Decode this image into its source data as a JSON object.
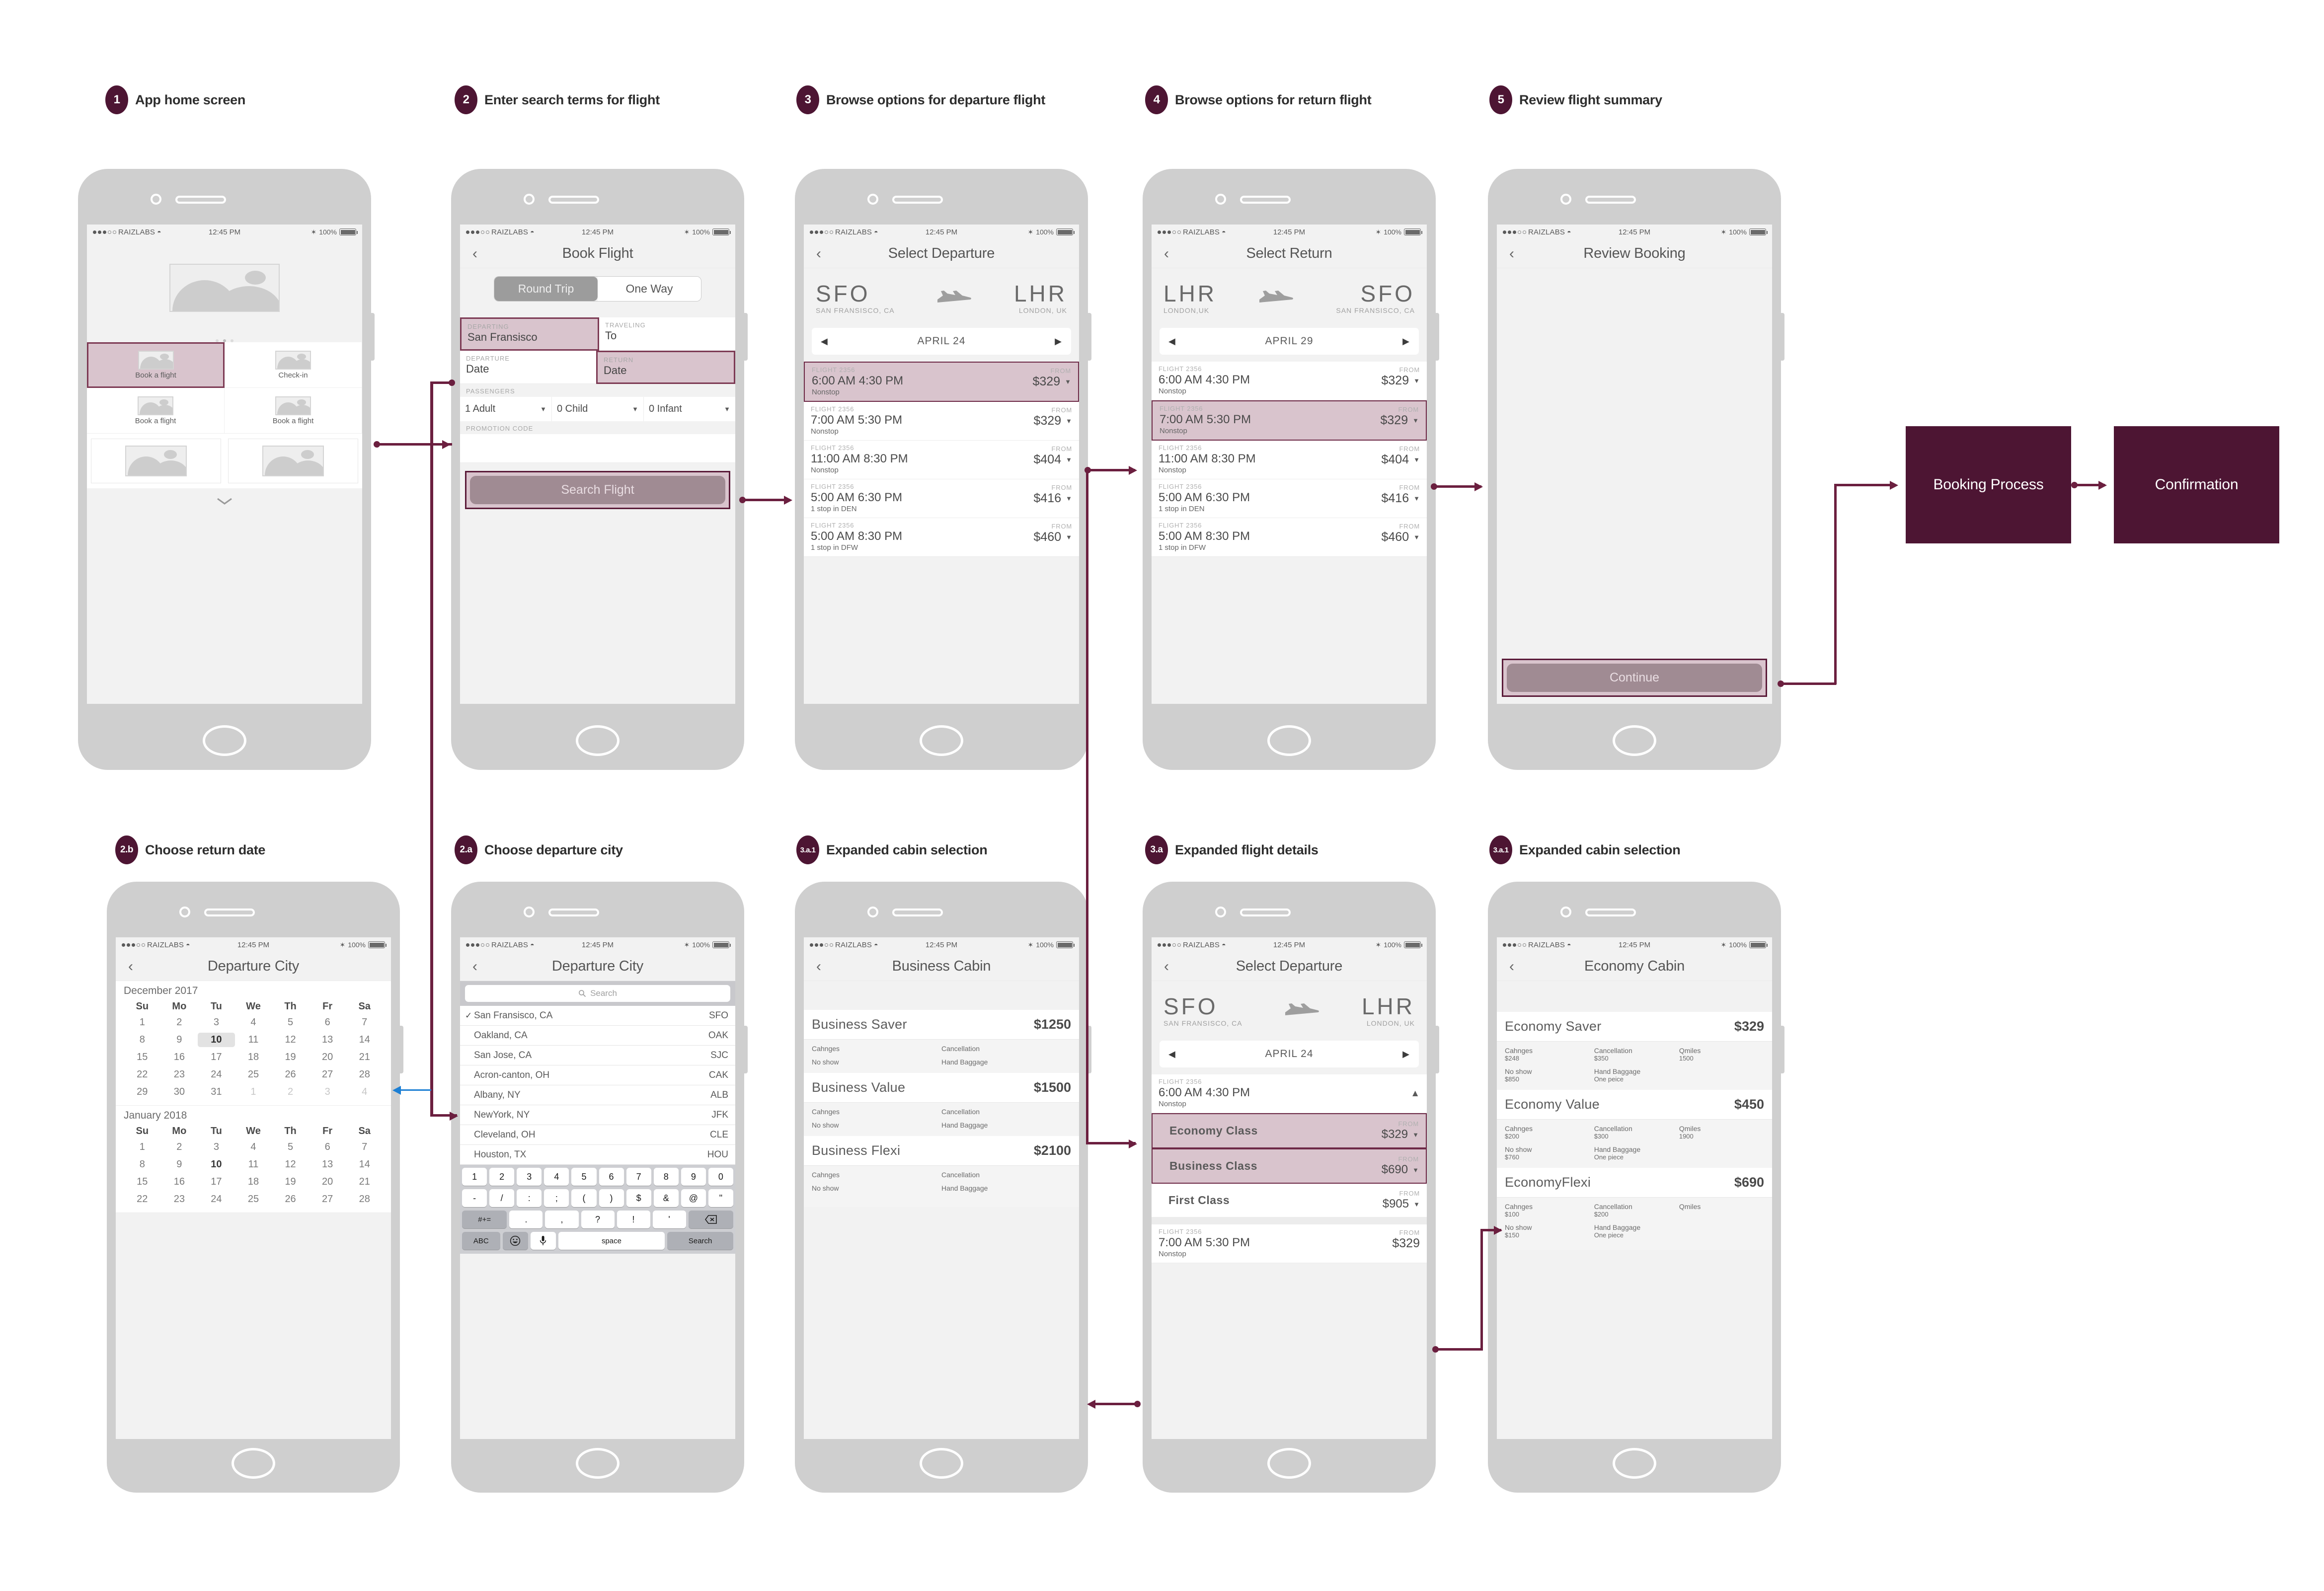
{
  "status_bar": {
    "carrier": "RAIZLABS",
    "time": "12:45 PM",
    "battery": "100%"
  },
  "steps": [
    {
      "num": "1",
      "label": "App home screen"
    },
    {
      "num": "2",
      "label": "Enter search terms for flight"
    },
    {
      "num": "3",
      "label": "Browse options for departure flight"
    },
    {
      "num": "4",
      "label": "Browse options for return flight"
    },
    {
      "num": "5",
      "label": "Review flight summary"
    },
    {
      "num": "2.b",
      "label": "Choose return date"
    },
    {
      "num": "2.a",
      "label": "Choose departure city"
    },
    {
      "num": "3.a.1",
      "label": "Expanded cabin selection"
    },
    {
      "num": "3.a",
      "label": "Expanded flight details"
    },
    {
      "num": "3.a.1",
      "label": "Expanded cabin selection"
    }
  ],
  "home": {
    "tiles": [
      {
        "label": "Book a flight",
        "selected": true
      },
      {
        "label": "Check-in",
        "selected": false
      },
      {
        "label": "Book a flight",
        "selected": false
      },
      {
        "label": "Book a flight",
        "selected": false
      }
    ]
  },
  "book_flight": {
    "title": "Book Flight",
    "segments": [
      {
        "label": "Round Trip",
        "active": true
      },
      {
        "label": "One Way",
        "active": false
      }
    ],
    "fields": [
      {
        "label": "DEPARTING",
        "value": "San Fransisco",
        "highlight": true
      },
      {
        "label": "TRAVELING",
        "value": "To",
        "highlight": false
      },
      {
        "label": "DEPARTURE",
        "value": "Date",
        "highlight": false
      },
      {
        "label": "RETURN",
        "value": "Date",
        "highlight": true
      }
    ],
    "passengers_label": "PASSENGERS",
    "passengers": [
      "1 Adult",
      "0 Child",
      "0 Infant"
    ],
    "promo_label": "PROMOTION CODE",
    "promo_value": "",
    "search_button": "Search Flight"
  },
  "select_departure": {
    "title": "Select Departure",
    "origin_code": "SFO",
    "origin_city": "SAN FRANSISCO, CA",
    "dest_code": "LHR",
    "dest_city": "LONDON, UK",
    "date": "APRIL 24",
    "flights": [
      {
        "no": "FLIGHT 2356",
        "time": "6:00 AM 4:30 PM",
        "stop": "Nonstop",
        "from": "FROM",
        "price": "$329",
        "selected": true
      },
      {
        "no": "FLIGHT 2356",
        "time": "7:00 AM 5:30 PM",
        "stop": "Nonstop",
        "from": "FROM",
        "price": "$329",
        "selected": false
      },
      {
        "no": "FLIGHT 2356",
        "time": "11:00 AM 8:30 PM",
        "stop": "Nonstop",
        "from": "FROM",
        "price": "$404",
        "selected": false
      },
      {
        "no": "FLIGHT 2356",
        "time": "5:00 AM 6:30 PM",
        "stop": "1 stop in DEN",
        "from": "FROM",
        "price": "$416",
        "selected": false
      },
      {
        "no": "FLIGHT 2356",
        "time": "5:00 AM 8:30 PM",
        "stop": "1 stop in DFW",
        "from": "FROM",
        "price": "$460",
        "selected": false
      }
    ]
  },
  "select_return": {
    "title": "Select Return",
    "origin_code": "LHR",
    "origin_city": "LONDON,UK",
    "dest_code": "SFO",
    "dest_city": "SAN FRANSISCO, CA",
    "date": "APRIL 29",
    "flights": [
      {
        "no": "FLIGHT 2356",
        "time": "6:00 AM 4:30 PM",
        "stop": "Nonstop",
        "from": "FROM",
        "price": "$329",
        "selected": false
      },
      {
        "no": "FLIGHT 2356",
        "time": "7:00 AM 5:30 PM",
        "stop": "Nonstop",
        "from": "FROM",
        "price": "$329",
        "selected": true
      },
      {
        "no": "FLIGHT 2356",
        "time": "11:00 AM 8:30 PM",
        "stop": "Nonstop",
        "from": "FROM",
        "price": "$404",
        "selected": false
      },
      {
        "no": "FLIGHT 2356",
        "time": "5:00 AM 6:30 PM",
        "stop": "1 stop in DEN",
        "from": "FROM",
        "price": "$416",
        "selected": false
      },
      {
        "no": "FLIGHT 2356",
        "time": "5:00 AM 8:30 PM",
        "stop": "1 stop in DFW",
        "from": "FROM",
        "price": "$460",
        "selected": false
      }
    ]
  },
  "review_booking": {
    "title": "Review Booking",
    "continue_button": "Continue"
  },
  "process_boxes": [
    {
      "label": "Booking Process"
    },
    {
      "label": "Confirmation"
    }
  ],
  "calendar_screen": {
    "title": "Departure City",
    "months": [
      {
        "name": "December 2017",
        "dow": [
          "Su",
          "Mo",
          "Tu",
          "We",
          "Th",
          "Fr",
          "Sa"
        ],
        "weeks": [
          [
            {
              "d": "1"
            },
            {
              "d": "2"
            },
            {
              "d": "3"
            },
            {
              "d": "4"
            },
            {
              "d": "5"
            },
            {
              "d": "6"
            },
            {
              "d": "7"
            }
          ],
          [
            {
              "d": "8"
            },
            {
              "d": "9"
            },
            {
              "d": "10",
              "state": "sel"
            },
            {
              "d": "11"
            },
            {
              "d": "12"
            },
            {
              "d": "13"
            },
            {
              "d": "14"
            }
          ],
          [
            {
              "d": "15"
            },
            {
              "d": "16"
            },
            {
              "d": "17"
            },
            {
              "d": "18"
            },
            {
              "d": "19"
            },
            {
              "d": "20"
            },
            {
              "d": "21"
            }
          ],
          [
            {
              "d": "22"
            },
            {
              "d": "23"
            },
            {
              "d": "24"
            },
            {
              "d": "25"
            },
            {
              "d": "26"
            },
            {
              "d": "27"
            },
            {
              "d": "28"
            }
          ],
          [
            {
              "d": "29"
            },
            {
              "d": "30"
            },
            {
              "d": "31"
            },
            {
              "d": "1",
              "state": "dim"
            },
            {
              "d": "2",
              "state": "dim"
            },
            {
              "d": "3",
              "state": "dim"
            },
            {
              "d": "4",
              "state": "dim"
            }
          ]
        ]
      },
      {
        "name": "January 2018",
        "dow": [
          "Su",
          "Mo",
          "Tu",
          "We",
          "Th",
          "Fr",
          "Sa"
        ],
        "weeks": [
          [
            {
              "d": "1"
            },
            {
              "d": "2"
            },
            {
              "d": "3"
            },
            {
              "d": "4"
            },
            {
              "d": "5"
            },
            {
              "d": "6"
            },
            {
              "d": "7"
            }
          ],
          [
            {
              "d": "8"
            },
            {
              "d": "9"
            },
            {
              "d": "10",
              "state": "bold"
            },
            {
              "d": "11"
            },
            {
              "d": "12"
            },
            {
              "d": "13"
            },
            {
              "d": "14"
            }
          ],
          [
            {
              "d": "15"
            },
            {
              "d": "16"
            },
            {
              "d": "17"
            },
            {
              "d": "18"
            },
            {
              "d": "19"
            },
            {
              "d": "20"
            },
            {
              "d": "21"
            }
          ],
          [
            {
              "d": "22"
            },
            {
              "d": "23"
            },
            {
              "d": "24"
            },
            {
              "d": "25"
            },
            {
              "d": "26"
            },
            {
              "d": "27"
            },
            {
              "d": "28"
            }
          ]
        ]
      }
    ]
  },
  "departure_city": {
    "title": "Departure City",
    "search_placeholder": "Search",
    "cities": [
      {
        "name": "San Fransisco, CA",
        "code": "SFO",
        "checked": true
      },
      {
        "name": "Oakland, CA",
        "code": "OAK",
        "checked": false
      },
      {
        "name": "San Jose, CA",
        "code": "SJC",
        "checked": false
      },
      {
        "name": "Acron-canton, OH",
        "code": "CAK",
        "checked": false
      },
      {
        "name": "Albany, NY",
        "code": "ALB",
        "checked": false
      },
      {
        "name": "NewYork, NY",
        "code": "JFK",
        "checked": false
      },
      {
        "name": "Cleveland, OH",
        "code": "CLE",
        "checked": false
      },
      {
        "name": "Houston, TX",
        "code": "HOU",
        "checked": false
      }
    ],
    "keyboard": {
      "row1": [
        "1",
        "2",
        "3",
        "4",
        "5",
        "6",
        "7",
        "8",
        "9",
        "0"
      ],
      "row2": [
        "-",
        "/",
        ":",
        ";",
        "(",
        ")",
        "$",
        "&",
        "@",
        "\""
      ],
      "row3": [
        "#+=",
        ".",
        ",",
        "?",
        "!",
        "'",
        "⌫"
      ],
      "row4": [
        "ABC",
        "☺",
        "🎤",
        "space",
        "Search"
      ]
    }
  },
  "business_cabin": {
    "title": "Business Cabin",
    "fares": [
      {
        "name": "Business Saver",
        "price": "$1250",
        "details": [
          {
            "k": "Cahnges",
            "v": ""
          },
          {
            "k": "Cancellation",
            "v": ""
          },
          {
            "k": "No show",
            "v": ""
          },
          {
            "k": "Hand Baggage",
            "v": ""
          }
        ]
      },
      {
        "name": "Business Value",
        "price": "$1500",
        "details": [
          {
            "k": "Cahnges",
            "v": ""
          },
          {
            "k": "Cancellation",
            "v": ""
          },
          {
            "k": "No show",
            "v": ""
          },
          {
            "k": "Hand Baggage",
            "v": ""
          }
        ]
      },
      {
        "name": "Business Flexi",
        "price": "$2100",
        "details": [
          {
            "k": "Cahnges",
            "v": ""
          },
          {
            "k": "Cancellation",
            "v": ""
          },
          {
            "k": "No show",
            "v": ""
          },
          {
            "k": "Hand Baggage",
            "v": ""
          }
        ]
      }
    ]
  },
  "expanded_flight": {
    "title": "Select Departure",
    "origin_code": "SFO",
    "origin_city": "SAN FRANSISCO, CA",
    "dest_code": "LHR",
    "dest_city": "LONDON, UK",
    "date": "APRIL 24",
    "header_flight": {
      "no": "FLIGHT 2356",
      "time": "6:00 AM 4:30 PM",
      "stop": "Nonstop"
    },
    "classes": [
      {
        "name": "Economy Class",
        "from": "FROM",
        "price": "$329",
        "selected": true
      },
      {
        "name": "Business Class",
        "from": "FROM",
        "price": "$690",
        "selected": true
      },
      {
        "name": "First Class",
        "from": "FROM",
        "price": "$905",
        "selected": false
      }
    ],
    "next_flight": {
      "no": "FLIGHT 2356",
      "time": "7:00 AM 5:30 PM",
      "stop": "Nonstop",
      "from": "FROM",
      "price": "$329"
    }
  },
  "economy_cabin": {
    "title": "Economy Cabin",
    "fares": [
      {
        "name": "Economy Saver",
        "price": "$329",
        "changes_k": "Cahnges",
        "changes_v": "$248",
        "cancel_k": "Cancellation",
        "cancel_v": "$350",
        "miles_k": "Qmiles",
        "miles_v": "1500",
        "noshow_k": "No show",
        "noshow_v": "$850",
        "bag_k": "Hand Baggage",
        "bag_v": "One peice"
      },
      {
        "name": "Economy Value",
        "price": "$450",
        "changes_k": "Cahnges",
        "changes_v": "$200",
        "cancel_k": "Cancellation",
        "cancel_v": "$300",
        "miles_k": "Qmiles",
        "miles_v": "1900",
        "noshow_k": "No show",
        "noshow_v": "$760",
        "bag_k": "Hand Baggage",
        "bag_v": "One piece"
      },
      {
        "name": "EconomyFlexi",
        "price": "$690",
        "changes_k": "Cahnges",
        "changes_v": "$100",
        "cancel_k": "Cancellation",
        "cancel_v": "$200",
        "miles_k": "Qmiles",
        "miles_v": "",
        "noshow_k": "No show",
        "noshow_v": "$150",
        "bag_k": "Hand Baggage",
        "bag_v": "One piece"
      }
    ]
  },
  "colors": {
    "accent": "#4d1533",
    "connector": "#6b1f3f",
    "highlight_fill": "#d9c4cd",
    "highlight_border": "#6e2a47",
    "blue_arrow": "#1c7fd4"
  }
}
